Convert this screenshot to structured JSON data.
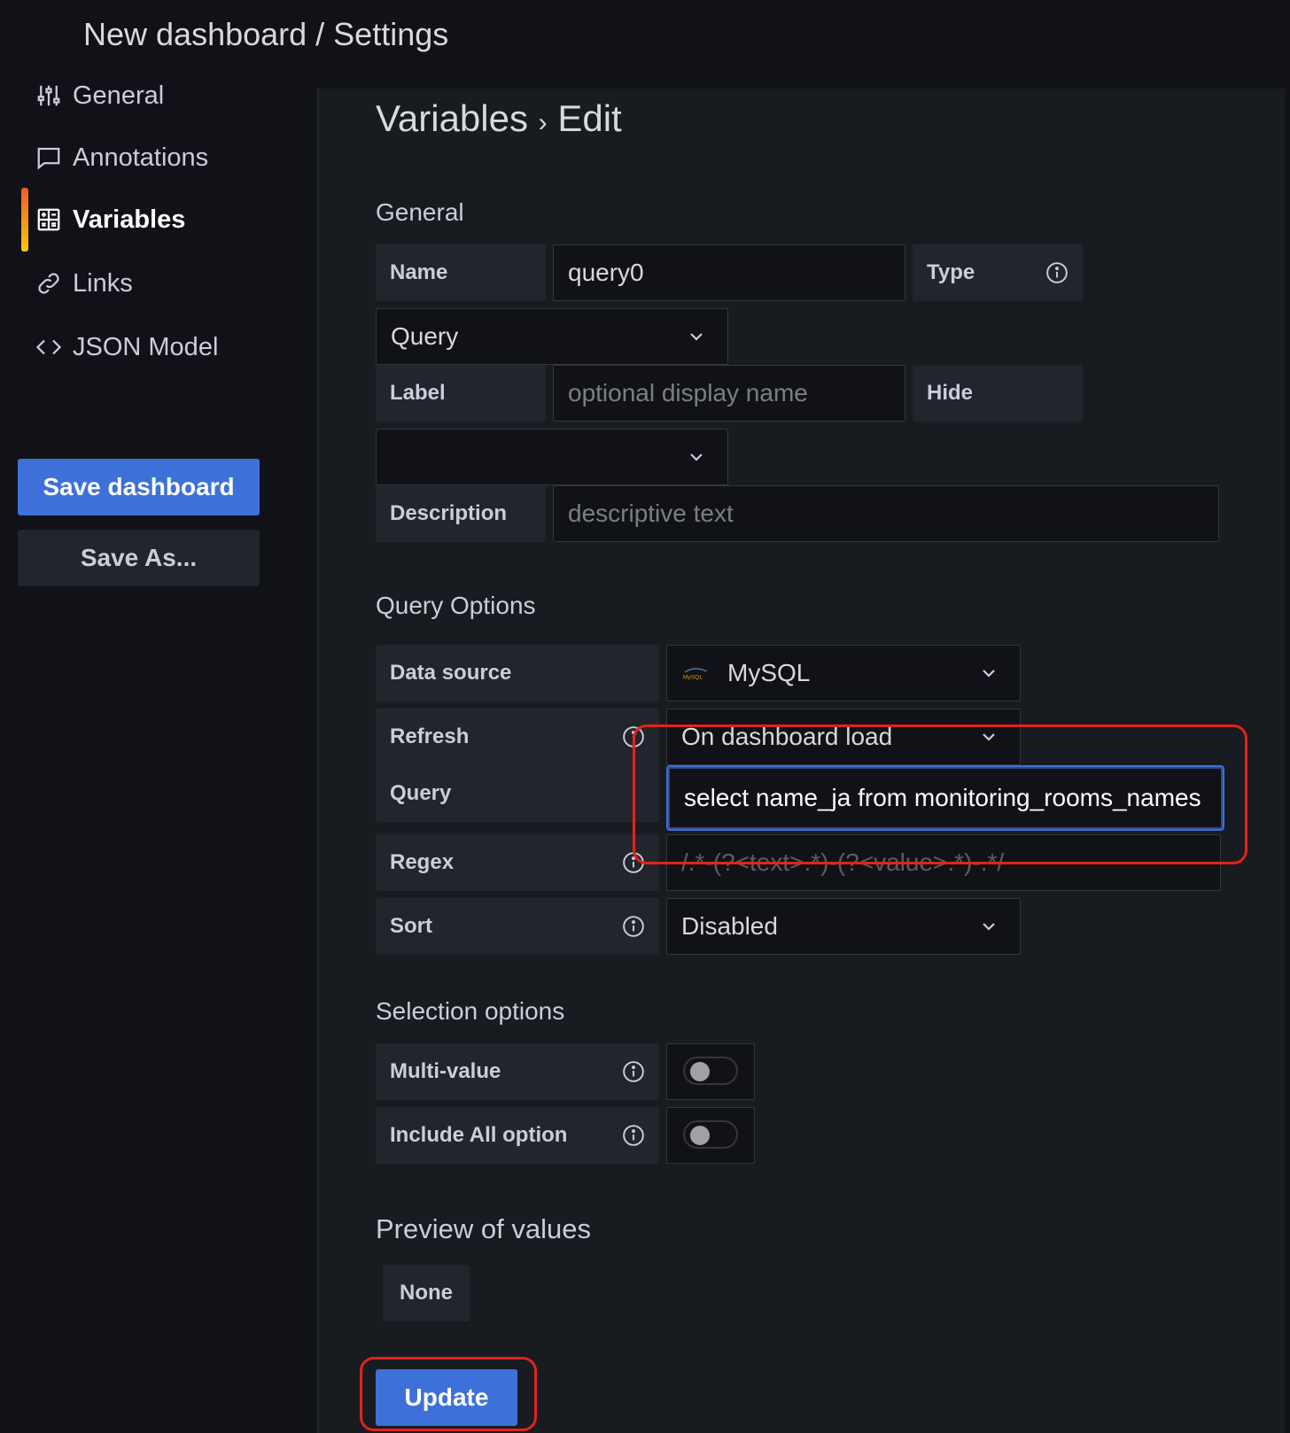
{
  "header": {
    "title": "New dashboard / Settings"
  },
  "sidebar": {
    "items": [
      {
        "label": "General",
        "icon": "sliders-icon"
      },
      {
        "label": "Annotations",
        "icon": "comment-icon"
      },
      {
        "label": "Variables",
        "icon": "calculator-icon",
        "active": true
      },
      {
        "label": "Links",
        "icon": "link-icon"
      },
      {
        "label": "JSON Model",
        "icon": "code-icon"
      }
    ],
    "save_label": "Save dashboard",
    "save_as_label": "Save As..."
  },
  "main": {
    "heading": "Variables",
    "heading_sep": "›",
    "heading_sub": "Edit",
    "general": {
      "title": "General",
      "name_label": "Name",
      "name_value": "query0",
      "type_label": "Type",
      "type_value": "Query",
      "label_label": "Label",
      "label_placeholder": "optional display name",
      "hide_label": "Hide",
      "hide_value": "",
      "description_label": "Description",
      "description_placeholder": "descriptive text"
    },
    "query_options": {
      "title": "Query Options",
      "datasource_label": "Data source",
      "datasource_value": "MySQL",
      "datasource_logo_text": "MySQL",
      "refresh_label": "Refresh",
      "refresh_value": "On dashboard load",
      "query_label": "Query",
      "query_value": "select name_ja from monitoring_rooms_names",
      "regex_label": "Regex",
      "regex_placeholder": "/.*-(?<text>.*)-(?<value>.*)-.*/",
      "sort_label": "Sort",
      "sort_value": "Disabled"
    },
    "selection": {
      "title": "Selection options",
      "multi_label": "Multi-value",
      "multi_on": false,
      "include_all_label": "Include All option",
      "include_all_on": false
    },
    "preview": {
      "title": "Preview of values",
      "value": "None"
    },
    "update_label": "Update"
  },
  "colors": {
    "primary": "#3d71d9",
    "highlight": "#e2231a",
    "focus": "#3b6fe0",
    "accent_start": "#f05a28",
    "accent_end": "#fbca0a"
  }
}
